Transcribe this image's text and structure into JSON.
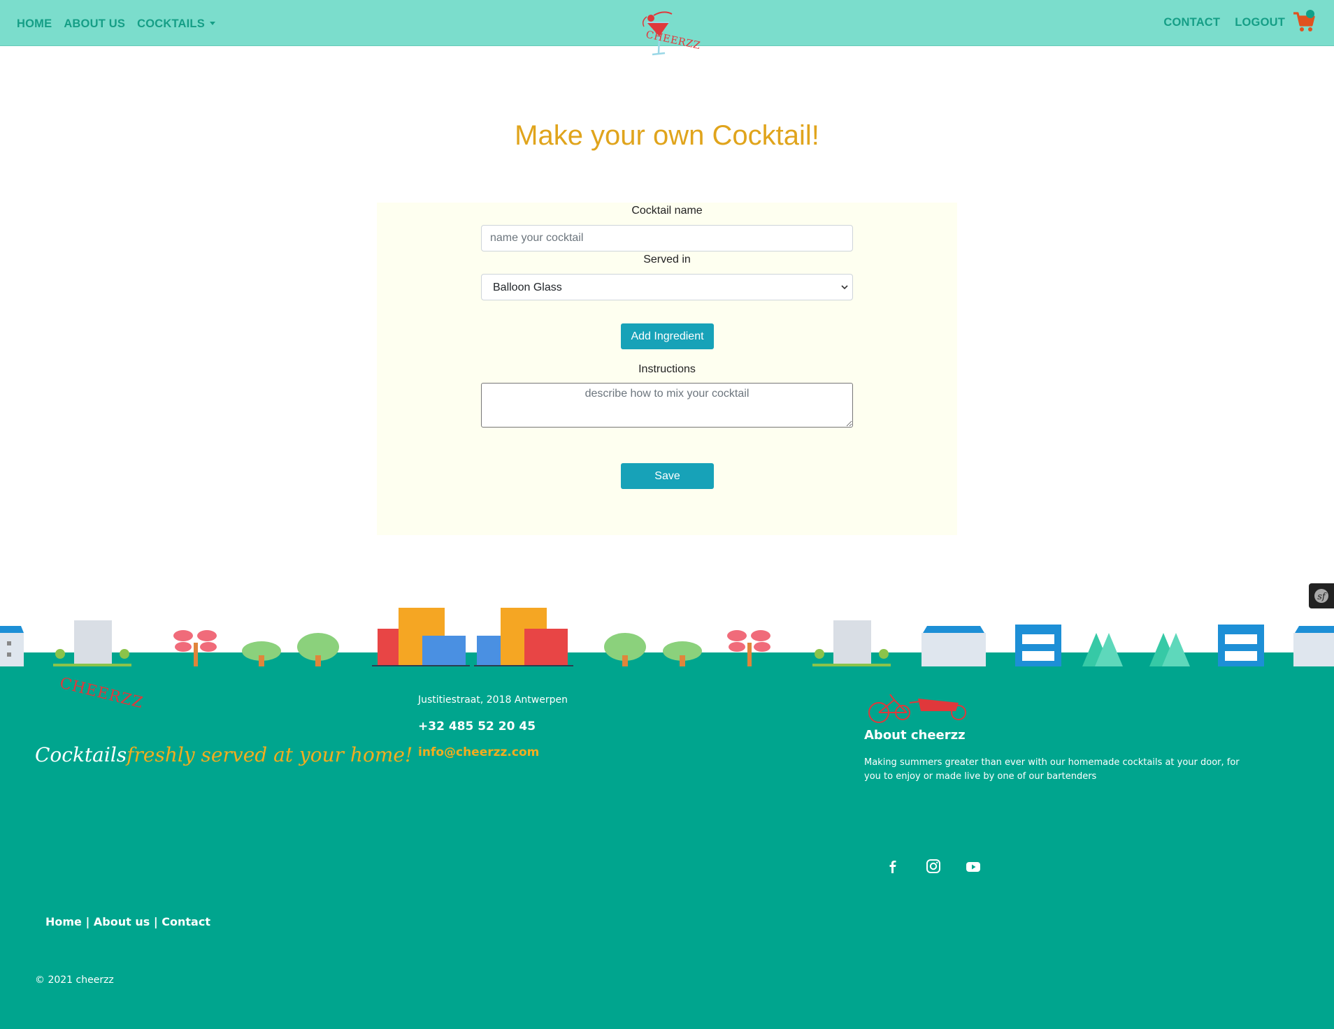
{
  "nav": {
    "left": [
      "HOME",
      "ABOUT US",
      "COCKTAILS"
    ],
    "right": [
      "CONTACT",
      "LOGOUT"
    ],
    "logo_text": "CHEERZZ"
  },
  "main": {
    "title": "Make your own Cocktail!"
  },
  "form": {
    "name_label": "Cocktail name",
    "name_placeholder": "name your cocktail",
    "glass_label": "Served in",
    "glass_value": "Balloon Glass",
    "add_button": "Add Ingredient",
    "instructions_label": "Instructions",
    "instructions_placeholder": "describe how to mix your cocktail",
    "save_button": "Save"
  },
  "footer": {
    "logo_text": "CHEERZZ",
    "tagline_a": "Cocktails",
    "tagline_b": "freshly served at your home!",
    "address": "Justitiestraat, 2018 Antwerpen",
    "phone": "+32 485 52 20 45",
    "email": "info@cheerzz.com",
    "about_title": "About cheerzz",
    "about_text": "Making summers greater than ever with our homemade cocktails at your door, for you to enjoy or made live by one of our bartenders",
    "links": [
      "Home",
      "About us",
      "Contact"
    ],
    "separator": "|",
    "copyright": "© 2021 cheerzz"
  },
  "colors": {
    "nav_bg": "#7bddcc",
    "nav_link": "#159e86",
    "title": "#e0a41c",
    "button": "#17a2b8",
    "footer_bg": "#00a58e",
    "accent": "#f2ad1f",
    "brand_red": "#e0383b"
  },
  "icons": [
    "cart-icon",
    "chevron-down-icon",
    "symfony-icon",
    "facebook-icon",
    "instagram-icon",
    "youtube-icon",
    "bike-icon"
  ]
}
